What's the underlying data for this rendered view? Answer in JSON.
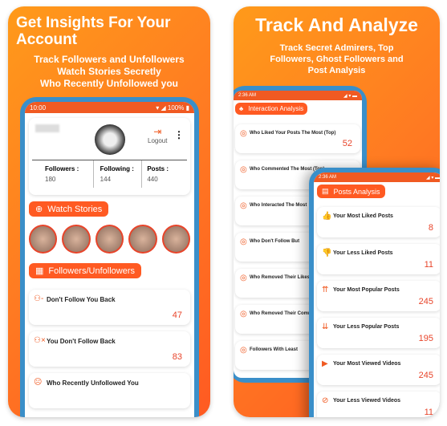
{
  "left": {
    "title_line1": "Get Insights For Your",
    "title_line2": "Account",
    "sub1": "Track Followers and Unfollowers",
    "sub2": "Watch Stories Secretly",
    "sub3": "Who Recently Unfollowed you",
    "status_time": "10:00",
    "battery": "100%",
    "logout": "Logout",
    "stats": [
      {
        "label": "Followers :",
        "value": "180"
      },
      {
        "label": "Following :",
        "value": "144"
      },
      {
        "label": "Posts :",
        "value": "440"
      }
    ],
    "watch_stories": "Watch Stories",
    "followers_section": "Followers/Unfollowers",
    "items": [
      {
        "label": "Don't Follow You Back",
        "value": "47",
        "icon": "user-minus-icon"
      },
      {
        "label": "You Don't Follow Back",
        "value": "83",
        "icon": "user-x-icon"
      },
      {
        "label": "Who Recently Unfollowed You",
        "value": "",
        "icon": "sad-face-icon"
      }
    ]
  },
  "right": {
    "title": "Track And Analyze",
    "sub1": "Track Secret Admirers, Top",
    "sub2": "Followers, Ghost Followers and",
    "sub3": "Post Analysis",
    "back_time": "2:36 AM",
    "interaction": "Interaction Analysis",
    "interaction_items": [
      {
        "label": "Who Liked Your Posts The Most (Top)",
        "value": "52"
      },
      {
        "label": "Who Commented The Most (Top)",
        "value": ""
      },
      {
        "label": "Who Interacted The Most",
        "value": ""
      },
      {
        "label": "Who Don't Follow But",
        "value": ""
      },
      {
        "label": "Who Removed Their Likes",
        "value": ""
      },
      {
        "label": "Who Removed Their Comments",
        "value": ""
      },
      {
        "label": "Followers With Least",
        "value": ""
      }
    ],
    "front_time": "2:36 AM",
    "posts": "Posts Analysis",
    "post_items": [
      {
        "label": "Your Most Liked Posts",
        "value": "8",
        "icon": "thumbs-up-icon"
      },
      {
        "label": "Your Less Liked Posts",
        "value": "11",
        "icon": "thumbs-down-icon"
      },
      {
        "label": "Your Most Popular Posts",
        "value": "245",
        "icon": "arrows-up-icon"
      },
      {
        "label": "Your Less Popular Posts",
        "value": "195",
        "icon": "arrows-down-icon"
      },
      {
        "label": "Your Most Viewed Videos",
        "value": "245",
        "icon": "video-icon"
      },
      {
        "label": "Your Less Viewed Videos",
        "value": "11",
        "icon": "video-off-icon"
      }
    ]
  },
  "colors": {
    "accent": "#ff5a22",
    "frame": "#3a8fc9",
    "value": "#e8442a"
  }
}
